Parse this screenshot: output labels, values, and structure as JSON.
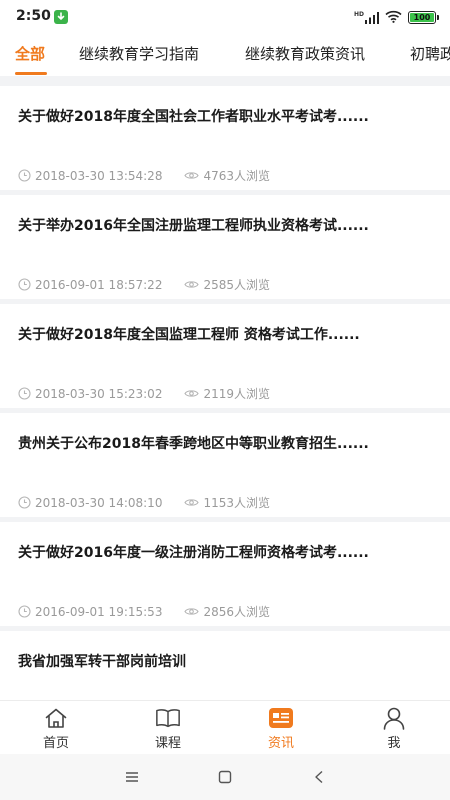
{
  "status_bar": {
    "time": "2:50",
    "signal_text": "HD",
    "battery": "100"
  },
  "tabs": [
    {
      "label": "全部",
      "active": true
    },
    {
      "label": "继续教育学习指南",
      "active": false
    },
    {
      "label": "继续教育政策资讯",
      "active": false
    },
    {
      "label": "初聘政",
      "active": false
    }
  ],
  "articles": [
    {
      "title": "关于做好2018年度全国社会工作者职业水平考试考......",
      "time": "2018-03-30 13:54:28",
      "views": "4763人浏览"
    },
    {
      "title": "关于举办2016年全国注册监理工程师执业资格考试......",
      "time": "2016-09-01 18:57:22",
      "views": "2585人浏览"
    },
    {
      "title": "关于做好2018年度全国监理工程师 资格考试工作......",
      "time": "2018-03-30 15:23:02",
      "views": "2119人浏览"
    },
    {
      "title": "贵州关于公布2018年春季跨地区中等职业教育招生......",
      "time": "2018-03-30 14:08:10",
      "views": "1153人浏览"
    },
    {
      "title": "关于做好2016年度一级注册消防工程师资格考试考......",
      "time": "2016-09-01 19:15:53",
      "views": "2856人浏览"
    },
    {
      "title": "我省加强军转干部岗前培训",
      "time": "",
      "views": ""
    }
  ],
  "bottom_nav": [
    {
      "label": "首页",
      "icon": "home-icon",
      "active": false
    },
    {
      "label": "课程",
      "icon": "book-icon",
      "active": false
    },
    {
      "label": "资讯",
      "icon": "news-icon",
      "active": true
    },
    {
      "label": "我",
      "icon": "user-icon",
      "active": false
    }
  ],
  "colors": {
    "accent": "#f07a1e",
    "meta": "#9a9a9a",
    "background": "#f2f3f5"
  }
}
